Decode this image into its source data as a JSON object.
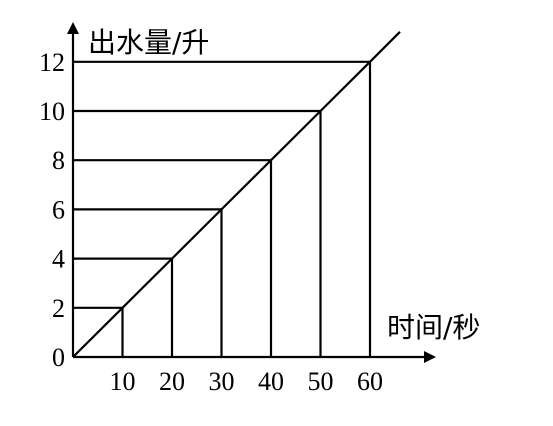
{
  "chart_data": {
    "type": "line",
    "title": "",
    "xlabel": "时间/秒",
    "ylabel": "出水量/升",
    "x_ticks": [
      10,
      20,
      30,
      40,
      50,
      60
    ],
    "y_ticks": [
      2,
      4,
      6,
      8,
      10,
      12
    ],
    "origin_label": "0",
    "xlim": [
      0,
      60
    ],
    "ylim": [
      0,
      12
    ],
    "grid": false,
    "guide_lines": true,
    "series": [
      {
        "x": [
          0,
          10,
          20,
          30,
          40,
          50,
          60
        ],
        "y": [
          0,
          2,
          4,
          6,
          8,
          10,
          12
        ]
      }
    ]
  }
}
